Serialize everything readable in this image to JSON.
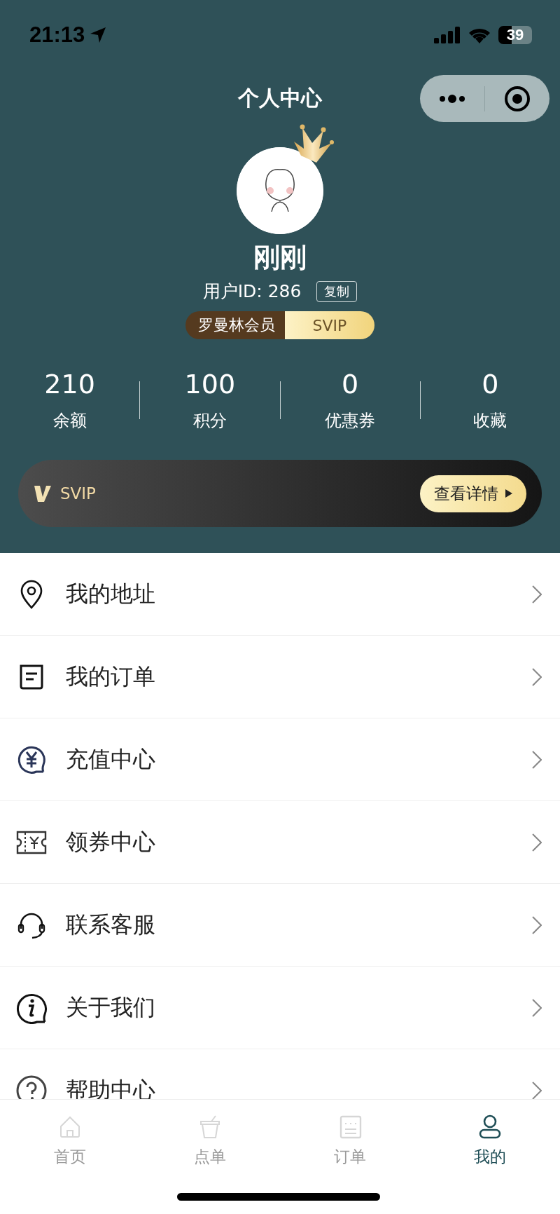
{
  "status_bar": {
    "time": "21:13",
    "battery": "39"
  },
  "nav": {
    "title": "个人中心"
  },
  "profile": {
    "name": "刚刚",
    "user_id": "用户ID: 286",
    "copy_button": "复制",
    "membership": {
      "tier": "罗曼林会员",
      "level": "SVIP"
    }
  },
  "stats": [
    {
      "value": "210",
      "label": "余额"
    },
    {
      "value": "100",
      "label": "积分"
    },
    {
      "value": "0",
      "label": "优惠券"
    },
    {
      "value": "0",
      "label": "收藏"
    }
  ],
  "svip_banner": {
    "label": "SVIP",
    "button": "查看详情"
  },
  "menu": [
    {
      "label": "我的地址",
      "kind": "pin"
    },
    {
      "label": "我的订单",
      "kind": "order"
    },
    {
      "label": "充值中心",
      "kind": "recharge"
    },
    {
      "label": "领券中心",
      "kind": "coupon"
    },
    {
      "label": "联系客服",
      "kind": "service"
    },
    {
      "label": "关于我们",
      "kind": "about"
    },
    {
      "label": "帮助中心",
      "kind": "help"
    }
  ],
  "tab_bar": [
    {
      "label": "首页",
      "kind": "home",
      "selected": false
    },
    {
      "label": "点单",
      "kind": "cup",
      "selected": false
    },
    {
      "label": "订单",
      "kind": "list",
      "selected": false
    },
    {
      "label": "我的",
      "kind": "user",
      "selected": true
    }
  ]
}
